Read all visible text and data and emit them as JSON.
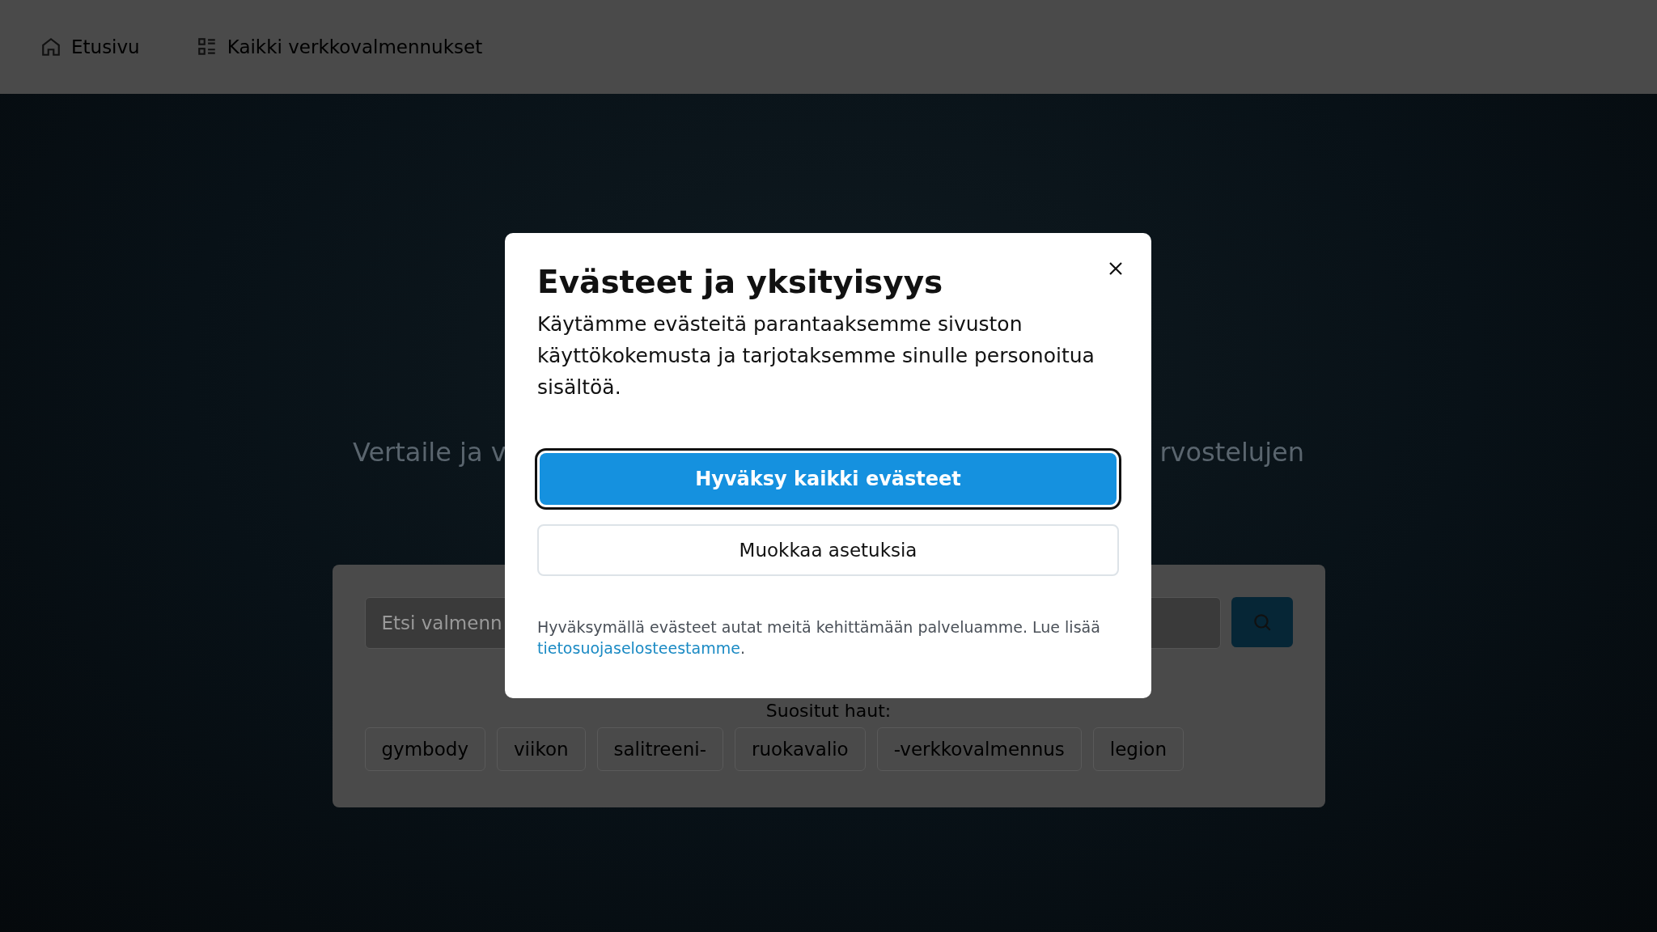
{
  "nav": {
    "items": [
      {
        "kind": "home",
        "label": "Etusivu"
      },
      {
        "kind": "list",
        "label": "Kaikki verkkovalmennukset"
      }
    ]
  },
  "hero": {
    "subtitle_left": "Vertaile ja v",
    "subtitle_right": "rvostelujen"
  },
  "search": {
    "placeholder": "Etsi valmenn",
    "popular_label": "Suositut haut:",
    "chips": [
      "gymbody",
      "viikon",
      "salitreeni-",
      "ruokavalio",
      "-verkkovalmennus",
      "legion"
    ]
  },
  "cookie_dialog": {
    "title": "Evästeet ja yksityisyys",
    "body": "Käytämme evästeitä parantaaksemme sivuston käyttökokemusta ja tarjotaksemme sinulle personoitua sisältöä.",
    "accept_button": "Hyväksy kaikki evästeet",
    "settings_button": "Muokkaa asetuksia",
    "footer_text": "Hyväksymällä evästeet autat meitä kehittämään palveluamme. Lue lisää",
    "footer_link": "tietosuojaselosteestamme",
    "footer_end": "."
  }
}
